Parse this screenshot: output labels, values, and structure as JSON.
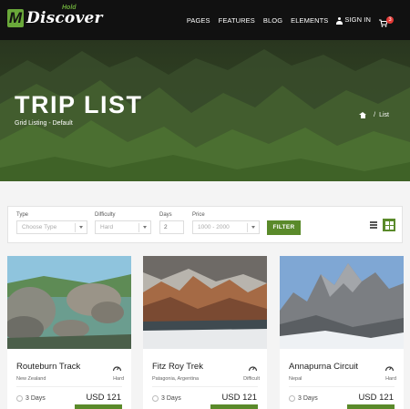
{
  "brand": {
    "name": "Discover",
    "sub": "Hold"
  },
  "nav": {
    "items": [
      "PAGES",
      "FEATURES",
      "BLOG",
      "ELEMENTS"
    ],
    "signin": "SIGN IN",
    "cart_count": "3"
  },
  "hero": {
    "title": "TRIP LIST",
    "subtitle": "Grid Listing - Default",
    "breadcrumb_current": "List"
  },
  "filter": {
    "type": {
      "label": "Type",
      "value": "Choose Type"
    },
    "difficulty": {
      "label": "Difficulty",
      "value": "Hard"
    },
    "days": {
      "label": "Days",
      "value": "2"
    },
    "price": {
      "label": "Price",
      "value": "1000 - 2000"
    },
    "button": "FILTER"
  },
  "trips": [
    {
      "title": "Routeburn Track",
      "location": "New Zealand",
      "difficulty": "Hard",
      "days": "3 Days",
      "price": "USD 121"
    },
    {
      "title": "Fitz Roy Trek",
      "location": "Patagonia, Argentina",
      "difficulty": "Difficult",
      "days": "3 Days",
      "price": "USD 121"
    },
    {
      "title": "Annapurna Circuit",
      "location": "Nepal",
      "difficulty": "Hard",
      "days": "3 Days",
      "price": "USD 121"
    }
  ],
  "colors": {
    "accent": "#5a8a2a",
    "header": "#111111",
    "badge": "#e53935"
  },
  "icons": [
    "user-icon",
    "cart-icon",
    "home-icon",
    "list-view-icon",
    "grid-view-icon",
    "gauge-icon",
    "sun-icon",
    "chevron-down-icon"
  ]
}
